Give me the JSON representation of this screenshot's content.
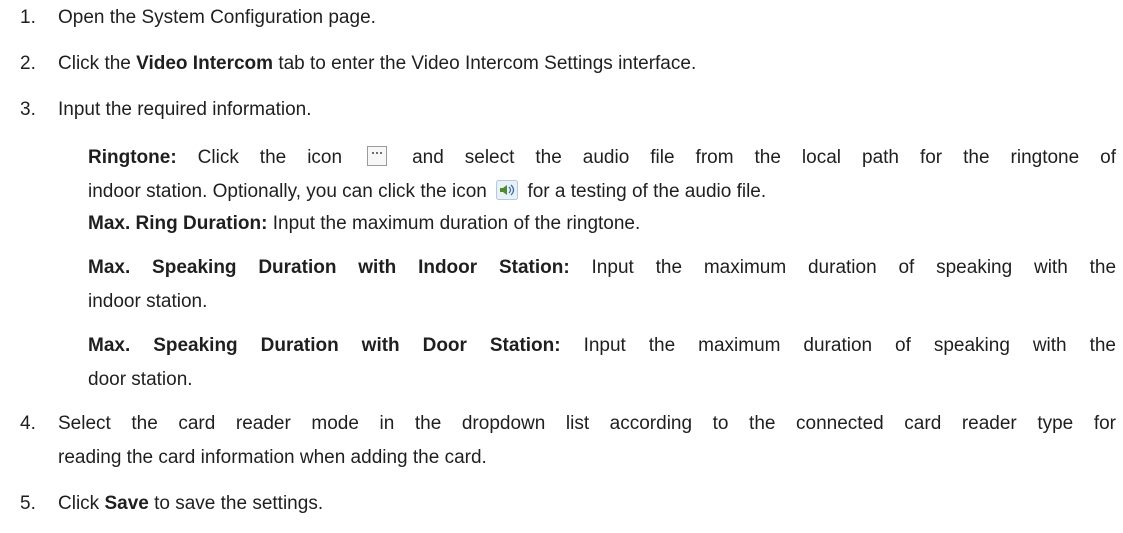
{
  "steps": [
    {
      "num": "1.",
      "text": "Open the System Configuration page."
    },
    {
      "num": "2.",
      "pre": "Click the ",
      "bold": "Video Intercom",
      "post": " tab to enter the Video Intercom Settings interface."
    },
    {
      "num": "3.",
      "text": "Input the required information.",
      "fields": [
        {
          "label": "Ringtone:",
          "line1_a": "Click the icon",
          "line1_b": "and select the audio file from the local path for the ringtone of",
          "line2_a": "indoor station. Optionally, you can click the icon",
          "line2_b": "for a testing of the audio file."
        },
        {
          "label": "Max. Ring Duration:",
          "text": "Input the maximum duration of the ringtone."
        },
        {
          "label": "Max. Speaking Duration with Indoor Station:",
          "text": "Input the maximum duration of speaking with the",
          "cont": "indoor station."
        },
        {
          "label": "Max. Speaking Duration with Door Station:",
          "text": "Input the maximum duration of speaking with the",
          "cont": "door station."
        }
      ]
    },
    {
      "num": "4.",
      "text": "Select the card reader mode in the dropdown list according to the connected card reader type for",
      "cont": "reading the card information when adding the card."
    },
    {
      "num": "5.",
      "pre": "Click ",
      "bold": "Save",
      "post": " to save the settings."
    }
  ],
  "icons": {
    "browse": "ellipsis-browse-icon",
    "play": "speaker-play-icon"
  }
}
